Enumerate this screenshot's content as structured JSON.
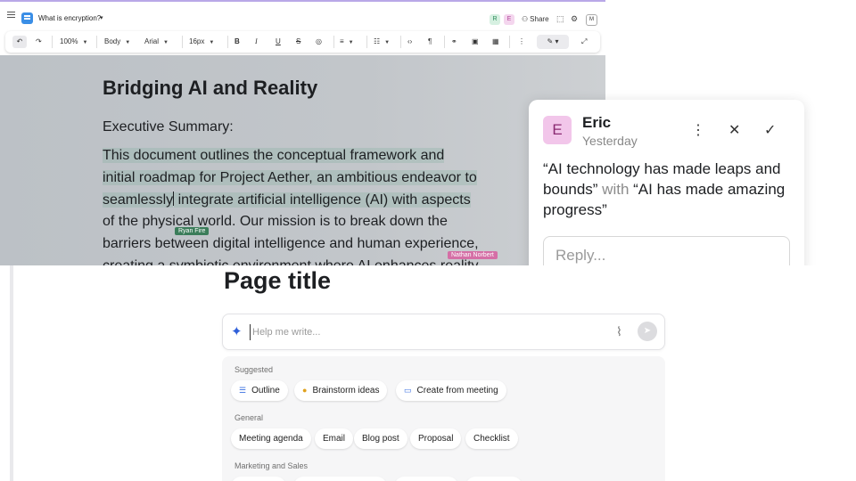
{
  "editor": {
    "doc_title": "What is encryption?",
    "collaborators": [
      "R",
      "E"
    ],
    "share_label": "Share",
    "user_initial": "M",
    "toolbar": {
      "zoom": "100%",
      "style": "Body",
      "font": "Arial",
      "size": "16px"
    },
    "heading": "Bridging AI and Reality",
    "subheading": "Executive Summary:",
    "paragraph_lines": [
      "This document outlines the conceptual framework and",
      "initial roadmap for Project Aether, an ambitious endeavor to",
      "seamlessly",
      "integrate artificial intelligence (AI) with aspects",
      "of the physical world. Our mission is to break down the",
      "barriers between digital intelligence and human experience,",
      "creating a symbiotic environment where AI enhances reality"
    ],
    "cursor_labels": {
      "ryan": "Ryan Fire",
      "nathan": "Nathan Norbert"
    }
  },
  "comment": {
    "author_initial": "E",
    "author": "Eric",
    "time": "Yesterday",
    "quote_original": "“AI technology has made leaps and bounds”",
    "with_word": "with",
    "quote_replacement": "“AI has made amazing progress”",
    "reply_placeholder": "Reply..."
  },
  "page": {
    "title": "Page title",
    "ai_placeholder": "Help me write...",
    "sections": {
      "suggested": "Suggested",
      "general": "General",
      "marketing": "Marketing and Sales"
    },
    "suggested_chips": [
      "Outline",
      "Brainstorm ideas",
      "Create from meeting"
    ],
    "general_chips": [
      "Meeting agenda",
      "Email",
      "Blog post",
      "Proposal",
      "Checklist"
    ]
  },
  "colors": {
    "accent": "#3a6fe0",
    "ryan_tag": "#3b7d5a",
    "nathan_tag": "#d56fa6",
    "comment_avatar": "#f2c6ea"
  },
  "icons": [
    "menu-icon",
    "doc-icon",
    "share-icon",
    "undo-icon",
    "redo-icon",
    "bold-icon",
    "italic-icon",
    "underline-icon",
    "strikethrough-icon",
    "paint-icon",
    "align-icon",
    "list-icon",
    "code-icon",
    "quote-icon",
    "link-icon",
    "image-icon",
    "table-icon",
    "more-icon",
    "pen-icon",
    "expand-icon",
    "sparkle-icon",
    "paperclip-icon",
    "send-icon"
  ]
}
